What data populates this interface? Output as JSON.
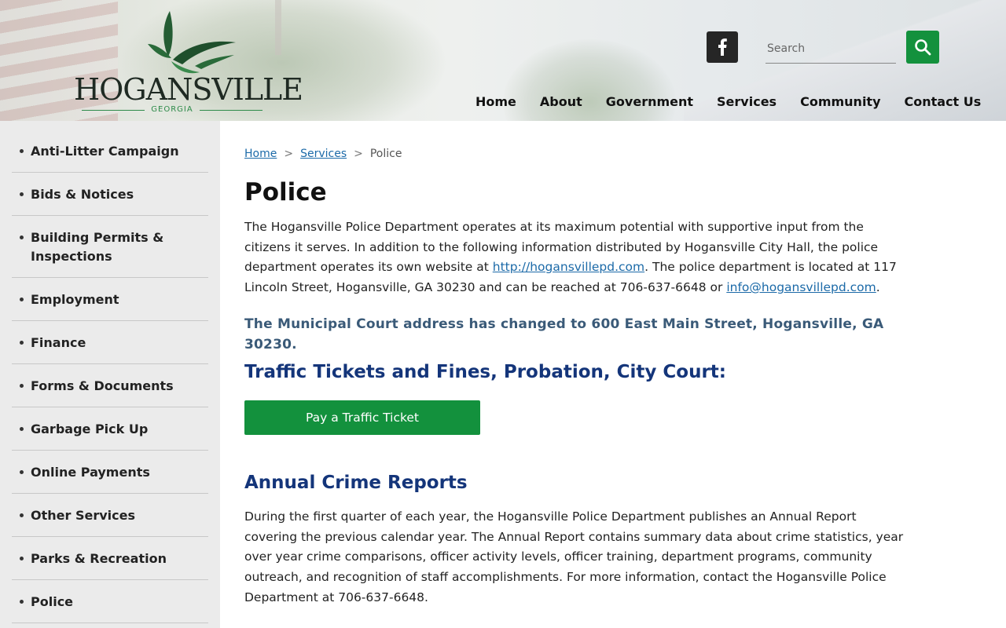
{
  "logo": {
    "wordmark": "HOGANSVILLE",
    "state": "GEORGIA"
  },
  "header": {
    "search_placeholder": "Search"
  },
  "nav": [
    {
      "label": "Home"
    },
    {
      "label": "About"
    },
    {
      "label": "Government"
    },
    {
      "label": "Services"
    },
    {
      "label": "Community"
    },
    {
      "label": "Contact Us"
    }
  ],
  "sidebar": {
    "items": [
      {
        "label": "Anti-Litter Campaign"
      },
      {
        "label": "Bids & Notices"
      },
      {
        "label": "Building Permits & Inspections"
      },
      {
        "label": "Employment"
      },
      {
        "label": "Finance"
      },
      {
        "label": "Forms & Documents"
      },
      {
        "label": "Garbage Pick Up"
      },
      {
        "label": "Online Payments"
      },
      {
        "label": "Other Services"
      },
      {
        "label": "Parks & Recreation"
      },
      {
        "label": "Police"
      }
    ]
  },
  "breadcrumb": {
    "home": "Home",
    "services": "Services",
    "current": "Police",
    "sep": ">"
  },
  "page": {
    "title": "Police",
    "intro_1": "The Hogansville Police Department operates at its maximum potential with supportive input from the citizens it serves. In addition to the following information distributed by Hogansville City Hall, the police department operates its own website at ",
    "intro_link_1": "http://hogansvillepd.com",
    "intro_2": ". The police department is located at 117 Lincoln Street, Hogansville, GA 30230 and can be reached at 706-637-6648 or ",
    "intro_link_2": "info@hogansvillepd.com",
    "intro_3": ".",
    "notice": "The Municipal Court address has changed to 600 East Main Street, Hogansville, GA  30230.",
    "traffic_heading": "Traffic Tickets and Fines, Probation, City Court:",
    "pay_button": "Pay a Traffic Ticket",
    "crime_heading": "Annual Crime Reports",
    "crime_text": "During the first quarter of each year, the Hogansville Police Department publishes an Annual Report covering the previous calendar year. The Annual Report contains summary data about crime statistics, year over year crime comparisons, officer activity levels, officer training, department programs, community outreach, and recognition of staff accomplishments. For more information, contact the Hogansville Police Department at 706-637-6648."
  },
  "colors": {
    "green": "#13913d",
    "navy": "#14357a",
    "link": "#1c6aa8",
    "notice": "#3a5a78",
    "sidebar_bg": "#ebebeb"
  },
  "icons": {
    "facebook": "facebook-icon",
    "search": "search-icon",
    "logo_bird": "bird-logo-icon",
    "bullet": "bullet-icon"
  }
}
